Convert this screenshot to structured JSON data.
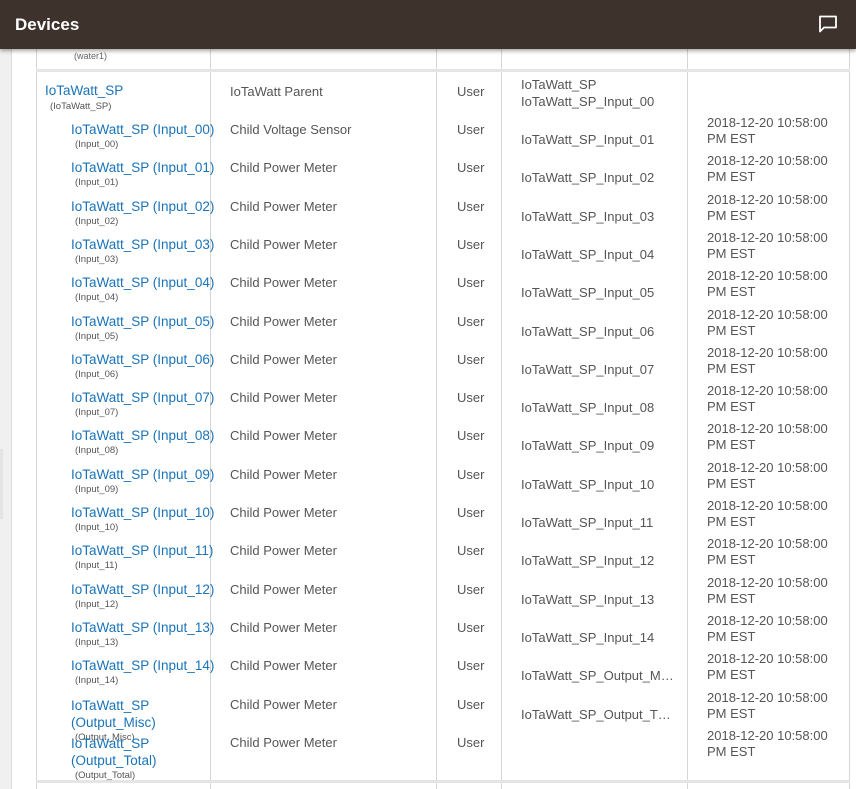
{
  "header": {
    "title": "Devices",
    "chat_icon": "chat-bubble-icon"
  },
  "previous_row": {
    "dni": "(water1)"
  },
  "parent": {
    "name": "IoTaWatt_SP",
    "dni": "(IoTaWatt_SP)",
    "type": "IoTaWatt Parent",
    "source": "User",
    "children_label": "IoTaWatt_SP",
    "first_child": "IoTaWatt_SP_Input_00"
  },
  "rows": [
    {
      "name": "IoTaWatt_SP (Input_00)",
      "dni": "(Input_00)",
      "type": "Child Voltage Sensor",
      "source": "User",
      "date": "2018-12-20 10:58:00 PM EST"
    },
    {
      "name": "IoTaWatt_SP (Input_01)",
      "dni": "(Input_01)",
      "type": "Child Power Meter",
      "source": "User",
      "date": "2018-12-20 10:58:00 PM EST"
    },
    {
      "name": "IoTaWatt_SP (Input_02)",
      "dni": "(Input_02)",
      "type": "Child Power Meter",
      "source": "User",
      "date": "2018-12-20 10:58:00 PM EST"
    },
    {
      "name": "IoTaWatt_SP (Input_03)",
      "dni": "(Input_03)",
      "type": "Child Power Meter",
      "source": "User",
      "date": "2018-12-20 10:58:00 PM EST"
    },
    {
      "name": "IoTaWatt_SP (Input_04)",
      "dni": "(Input_04)",
      "type": "Child Power Meter",
      "source": "User",
      "date": "2018-12-20 10:58:00 PM EST"
    },
    {
      "name": "IoTaWatt_SP (Input_05)",
      "dni": "(Input_05)",
      "type": "Child Power Meter",
      "source": "User",
      "date": "2018-12-20 10:58:00 PM EST"
    },
    {
      "name": "IoTaWatt_SP (Input_06)",
      "dni": "(Input_06)",
      "type": "Child Power Meter",
      "source": "User",
      "date": "2018-12-20 10:58:00 PM EST"
    },
    {
      "name": "IoTaWatt_SP (Input_07)",
      "dni": "(Input_07)",
      "type": "Child Power Meter",
      "source": "User",
      "date": "2018-12-20 10:58:00 PM EST"
    },
    {
      "name": "IoTaWatt_SP (Input_08)",
      "dni": "(Input_08)",
      "type": "Child Power Meter",
      "source": "User",
      "date": "2018-12-20 10:58:00 PM EST"
    },
    {
      "name": "IoTaWatt_SP (Input_09)",
      "dni": "(Input_09)",
      "type": "Child Power Meter",
      "source": "User",
      "date": "2018-12-20 10:58:00 PM EST"
    },
    {
      "name": "IoTaWatt_SP (Input_10)",
      "dni": "(Input_10)",
      "type": "Child Power Meter",
      "source": "User",
      "date": "2018-12-20 10:58:00 PM EST"
    },
    {
      "name": "IoTaWatt_SP (Input_11)",
      "dni": "(Input_11)",
      "type": "Child Power Meter",
      "source": "User",
      "date": "2018-12-20 10:58:00 PM EST"
    },
    {
      "name": "IoTaWatt_SP (Input_12)",
      "dni": "(Input_12)",
      "type": "Child Power Meter",
      "source": "User",
      "date": "2018-12-20 10:58:00 PM EST"
    },
    {
      "name": "IoTaWatt_SP (Input_13)",
      "dni": "(Input_13)",
      "type": "Child Power Meter",
      "source": "User",
      "date": "2018-12-20 10:58:00 PM EST"
    },
    {
      "name": "IoTaWatt_SP (Input_14)",
      "dni": "(Input_14)",
      "type": "Child Power Meter",
      "source": "User",
      "date": "2018-12-20 10:58:00 PM EST"
    },
    {
      "name_line1": "IoTaWatt_SP",
      "name_line2": "(Output_Misc)",
      "dni": "(Output_Misc)",
      "type": "Child Power Meter",
      "source": "User",
      "date": "2018-12-20 10:58:00 PM EST"
    },
    {
      "name_line1": "IoTaWatt_SP",
      "name_line2": "(Output_Total)",
      "dni": "(Output_Total)",
      "type": "Child Power Meter",
      "source": "User",
      "date": "2018-12-20 10:58:00 PM EST"
    }
  ],
  "children_list": [
    "IoTaWatt_SP_Input_01",
    "IoTaWatt_SP_Input_02",
    "IoTaWatt_SP_Input_03",
    "IoTaWatt_SP_Input_04",
    "IoTaWatt_SP_Input_05",
    "IoTaWatt_SP_Input_06",
    "IoTaWatt_SP_Input_07",
    "IoTaWatt_SP_Input_08",
    "IoTaWatt_SP_Input_09",
    "IoTaWatt_SP_Input_10",
    "IoTaWatt_SP_Input_11",
    "IoTaWatt_SP_Input_12",
    "IoTaWatt_SP_Input_13",
    "IoTaWatt_SP_Input_14",
    "IoTaWatt_SP_Output_M…",
    "IoTaWatt_SP_Output_T…"
  ],
  "last_row_type": "Child Power Meter",
  "last_row_source": "User",
  "last_row_date": "2018-12-20 10:58:00 PM EST"
}
